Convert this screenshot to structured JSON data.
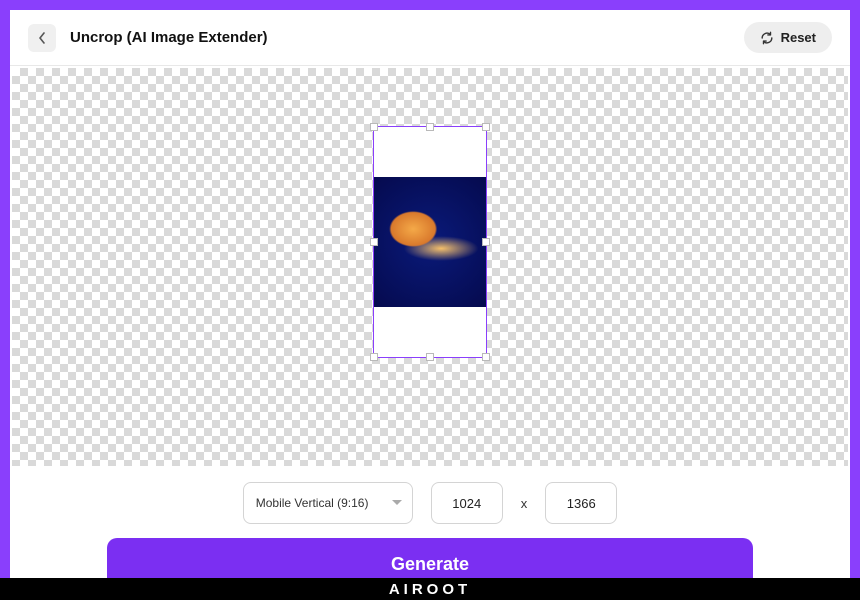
{
  "header": {
    "title": "Uncrop (AI Image Extender)",
    "reset_label": "Reset"
  },
  "controls": {
    "aspect_label": "Mobile Vertical (9:16)",
    "width_value": "1024",
    "separator": "x",
    "height_value": "1366",
    "generate_label": "Generate"
  },
  "brand": {
    "name": "AIROOT"
  }
}
